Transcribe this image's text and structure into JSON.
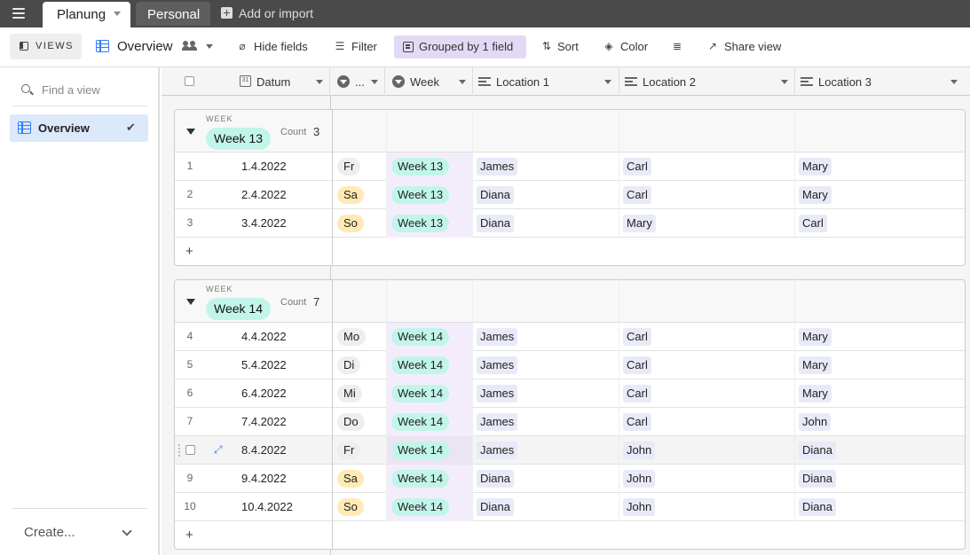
{
  "topbar": {
    "tabs": [
      {
        "label": "Planung",
        "active": true
      },
      {
        "label": "Personal",
        "active": false
      }
    ],
    "add_import": "Add or import"
  },
  "toolbar": {
    "views_label": "VIEWS",
    "view_name": "Overview",
    "hide_fields": "Hide fields",
    "filter": "Filter",
    "grouped": "Grouped by 1 field",
    "sort": "Sort",
    "color": "Color",
    "share": "Share view"
  },
  "sidebar": {
    "find_placeholder": "Find a view",
    "views": [
      {
        "label": "Overview",
        "selected": true
      }
    ],
    "create": "Create..."
  },
  "columns": [
    "Datum",
    "...",
    "Week",
    "Location 1",
    "Location 2",
    "Location 3"
  ],
  "groups": [
    {
      "field_label": "WEEK",
      "value": "Week 13",
      "count_label": "Count",
      "count": "3",
      "rows": [
        {
          "num": "1",
          "date": "1.4.2022",
          "day": "Fr",
          "week": "Week 13",
          "loc1": "James",
          "loc2": "Carl",
          "loc3": "Mary"
        },
        {
          "num": "2",
          "date": "2.4.2022",
          "day": "Sa",
          "week": "Week 13",
          "loc1": "Diana",
          "loc2": "Carl",
          "loc3": "Mary"
        },
        {
          "num": "3",
          "date": "3.4.2022",
          "day": "So",
          "week": "Week 13",
          "loc1": "Diana",
          "loc2": "Mary",
          "loc3": "Carl"
        }
      ]
    },
    {
      "field_label": "WEEK",
      "value": "Week 14",
      "count_label": "Count",
      "count": "7",
      "rows": [
        {
          "num": "4",
          "date": "4.4.2022",
          "day": "Mo",
          "week": "Week 14",
          "loc1": "James",
          "loc2": "Carl",
          "loc3": "Mary"
        },
        {
          "num": "5",
          "date": "5.4.2022",
          "day": "Di",
          "week": "Week 14",
          "loc1": "James",
          "loc2": "Carl",
          "loc3": "Mary"
        },
        {
          "num": "6",
          "date": "6.4.2022",
          "day": "Mi",
          "week": "Week 14",
          "loc1": "James",
          "loc2": "Carl",
          "loc3": "Mary"
        },
        {
          "num": "7",
          "date": "7.4.2022",
          "day": "Do",
          "week": "Week 14",
          "loc1": "James",
          "loc2": "Carl",
          "loc3": "John"
        },
        {
          "num": "",
          "date": "8.4.2022",
          "day": "Fr",
          "week": "Week 14",
          "loc1": "James",
          "loc2": "John",
          "loc3": "Diana",
          "hover": true
        },
        {
          "num": "9",
          "date": "9.4.2022",
          "day": "Sa",
          "week": "Week 14",
          "loc1": "Diana",
          "loc2": "John",
          "loc3": "Diana"
        },
        {
          "num": "10",
          "date": "10.4.2022",
          "day": "So",
          "week": "Week 14",
          "loc1": "Diana",
          "loc2": "John",
          "loc3": "Diana"
        }
      ]
    }
  ],
  "colors": {
    "accent": "#2d7ff9",
    "week_pill": "#c2f5e9",
    "weekend_pill": "#ffeab6",
    "weekday_pill": "#eeeeee",
    "record_chip": "#e9eaf8",
    "grouped_button": "#e4d9f5"
  }
}
